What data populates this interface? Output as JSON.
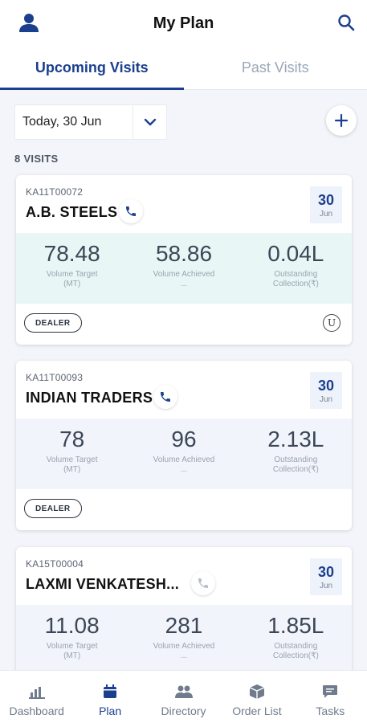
{
  "header": {
    "title": "My Plan",
    "profile_icon": "person-icon",
    "search_icon": "search-icon"
  },
  "tabs": [
    {
      "label": "Upcoming Visits",
      "active": true
    },
    {
      "label": "Past Visits",
      "active": false
    }
  ],
  "filter": {
    "date_label": "Today, 30 Jun"
  },
  "visits_count": "8 VISITS",
  "visits": [
    {
      "code": "KA11T00072",
      "name": "A.B. STEELS",
      "day": "30",
      "month": "Jun",
      "metrics": [
        {
          "value": "78.48",
          "label": "Volume Target (MT)"
        },
        {
          "value": "58.86",
          "label": "Volume Achieved ..."
        },
        {
          "value": "0.04L",
          "label": "Outstanding Collection(₹)"
        }
      ],
      "tag": "DEALER",
      "badge": "U"
    },
    {
      "code": "KA11T00093",
      "name": "INDIAN TRADERS",
      "day": "30",
      "month": "Jun",
      "metrics": [
        {
          "value": "78",
          "label": "Volume Target (MT)"
        },
        {
          "value": "96",
          "label": "Volume Achieved ..."
        },
        {
          "value": "2.13L",
          "label": "Outstanding Collection(₹)"
        }
      ],
      "tag": "DEALER"
    },
    {
      "code": "KA15T00004",
      "name": "LAXMI VENKATESH...",
      "day": "30",
      "month": "Jun",
      "metrics": [
        {
          "value": "11.08",
          "label": "Volume Target (MT)"
        },
        {
          "value": "281",
          "label": "Volume Achieved ..."
        },
        {
          "value": "1.85L",
          "label": "Outstanding Collection(₹)"
        }
      ]
    }
  ],
  "nav": [
    {
      "label": "Dashboard",
      "active": false
    },
    {
      "label": "Plan",
      "active": true
    },
    {
      "label": "Directory",
      "active": false
    },
    {
      "label": "Order List",
      "active": false
    },
    {
      "label": "Tasks",
      "active": false
    }
  ],
  "colors": {
    "primary": "#1b3f8f",
    "first_card_metrics_bg": "#e9f6f6",
    "card_metrics_bg": "#f1f4fa"
  }
}
